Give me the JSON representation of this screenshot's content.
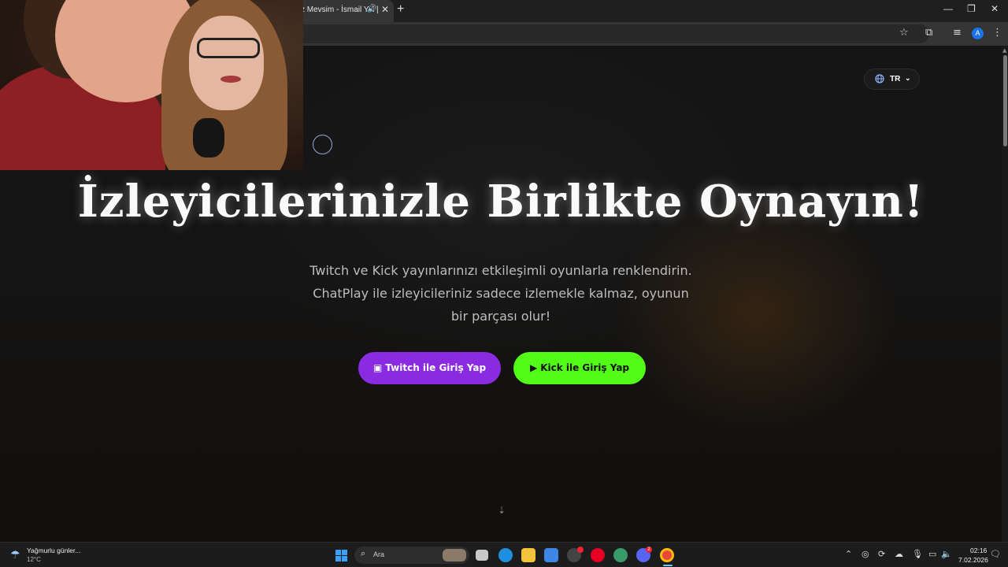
{
  "browser": {
    "tab_title": "z Mevsim - İsmail YK |",
    "new_tab": "+",
    "profile_initial": "A"
  },
  "page": {
    "language": "TR",
    "title": "İzleyicilerinizle Birlikte Oynayın!",
    "subtitle_lines": [
      "Twitch ve Kick yayınlarınızı etkileşimli oyunlarla renklendirin.",
      "ChatPlay ile izleyicileriniz sadece izlemekle kalmaz, oyunun",
      "bir parçası olur!"
    ],
    "twitch_button": "Twitch ile Giriş Yap",
    "kick_button": "Kick ile Giriş Yap",
    "twitch_color": "#8a2be2",
    "kick_color": "#53fc18"
  },
  "taskbar": {
    "weather_label": "Yağmurlu günler...",
    "weather_temp": "12°C",
    "search_placeholder": "Ara",
    "time": "02:16",
    "date": "7.02.2026",
    "discord_badge": "2"
  }
}
